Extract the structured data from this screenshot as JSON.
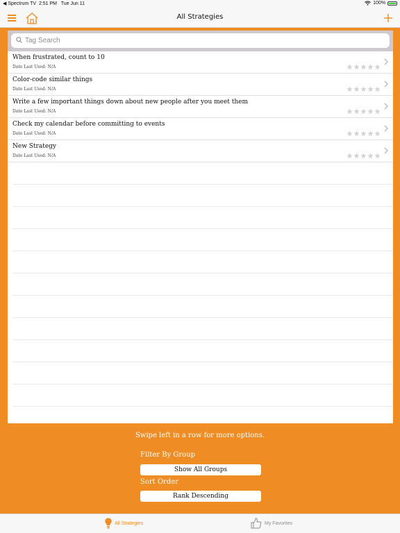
{
  "status_bar": {
    "back_app": "◀ Spectrum TV",
    "time": "2:51 PM",
    "date": "Tue Jun 11",
    "battery_percent": "100%",
    "battery_level": 1.0
  },
  "nav": {
    "title": "All Strategies",
    "menu_icon": "hamburger-icon",
    "home_icon": "home-icon",
    "add_icon": "plus-icon"
  },
  "search": {
    "placeholder": "Tag Search",
    "value": ""
  },
  "strategies": [
    {
      "title": "When frustrated, count to 10",
      "date_label": "Date Last Used: N/A",
      "rating": 0
    },
    {
      "title": "Color-code similar things",
      "date_label": "Date Last Used: N/A",
      "rating": 0
    },
    {
      "title": "Write a few important things down about new people after you meet them",
      "date_label": "Date Last Used: N/A",
      "rating": 0
    },
    {
      "title": "Check my calendar before committing to events",
      "date_label": "Date Last Used: N/A",
      "rating": 0
    },
    {
      "title": "New Strategy",
      "date_label": "Date Last Used: N/A",
      "rating": 0
    }
  ],
  "footer": {
    "hint": "Swipe left in a row for more options.",
    "filter_label": "Filter By Group",
    "filter_value": "Show All Groups",
    "sort_label": "Sort Order",
    "sort_value": "Rank Descending"
  },
  "tabs": [
    {
      "label": "All Strategies",
      "icon": "lightbulb-icon",
      "selected": true
    },
    {
      "label": "My Favorites",
      "icon": "thumbs-up-icon",
      "selected": false
    }
  ],
  "colors": {
    "accent": "#f08c24",
    "star_empty": "#d2d2d2",
    "battery": "#3cc23c"
  }
}
